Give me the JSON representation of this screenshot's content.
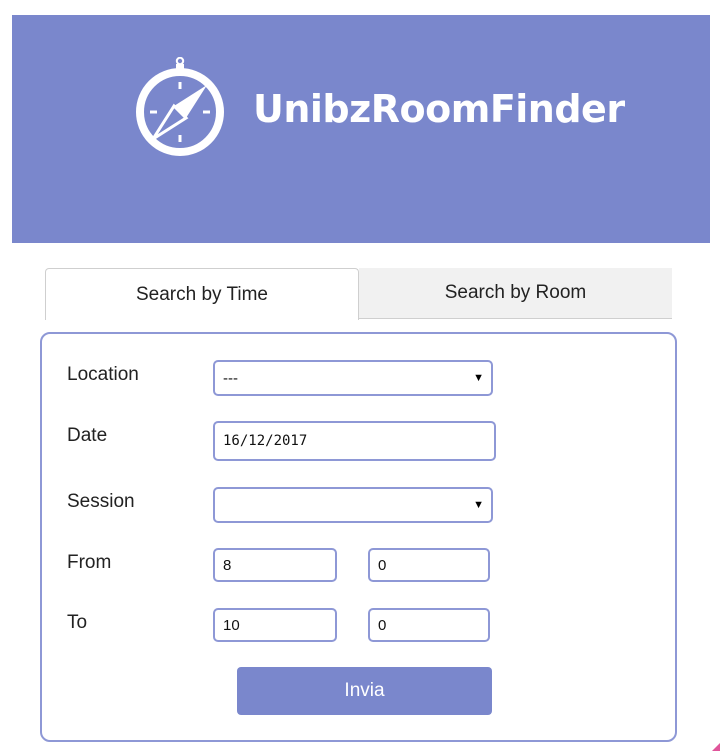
{
  "header": {
    "title": "UnibzRoomFinder",
    "logo_icon": "compass-icon",
    "background": "#7a87cc"
  },
  "tabs": [
    {
      "label": "Search by Time",
      "active": true
    },
    {
      "label": "Search by Room",
      "active": false
    }
  ],
  "form": {
    "location": {
      "label": "Location",
      "value": "---"
    },
    "date": {
      "label": "Date",
      "value": "16/12/2017"
    },
    "session": {
      "label": "Session",
      "value": ""
    },
    "from": {
      "label": "From",
      "hour": "8",
      "minute": "0"
    },
    "to": {
      "label": "To",
      "hour": "10",
      "minute": "0"
    },
    "submit_label": "Invia"
  },
  "colors": {
    "accent": "#7a87cc",
    "border": "#8e98d6"
  }
}
